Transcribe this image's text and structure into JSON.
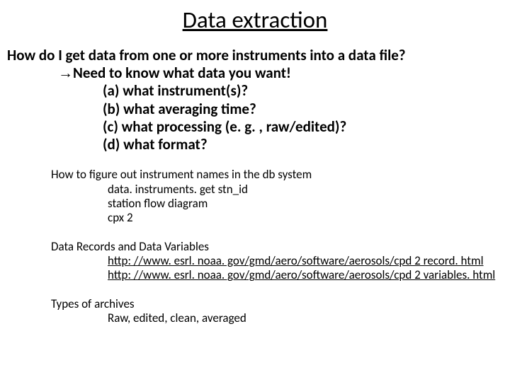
{
  "title": "Data extraction",
  "main_question": "How do I get data from one or more instruments into a data file?",
  "need_line_prefix": "→",
  "need_line": "Need to know what data you want!",
  "bullets": [
    "(a) what instrument(s)?",
    "(b) what averaging time?",
    "(c) what processing (e. g. , raw/edited)?",
    "(d) what format?"
  ],
  "sec1_lead": "How to figure out instrument names in the db system",
  "sec1_items": [
    "data. instruments. get stn_id",
    "station flow diagram",
    "cpx 2"
  ],
  "sec2_lead": "Data Records and Data Variables",
  "sec2_links": [
    "http: //www. esrl. noaa. gov/gmd/aero/software/aerosols/cpd 2 record. html",
    "http: //www. esrl. noaa. gov/gmd/aero/software/aerosols/cpd 2 variables. html"
  ],
  "sec3_lead": "Types of archives",
  "sec3_item": "Raw, edited, clean, averaged"
}
